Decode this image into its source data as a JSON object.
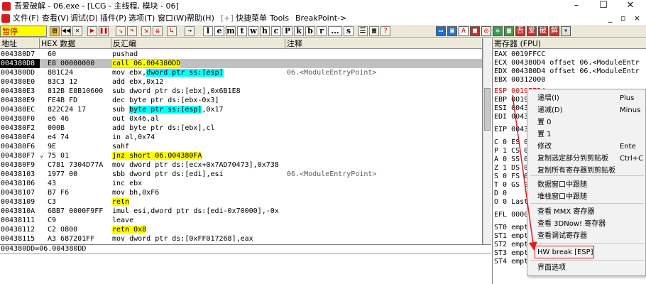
{
  "titlebar": {
    "title": "吾爱破解 - 06.exe - [LCG - 主线程, 模块 - 06]",
    "min": "–",
    "max": "☐",
    "close": "✕"
  },
  "menubar": {
    "items": [
      "文件(F)",
      "查看(V)",
      "调试(D)",
      "插件(P)",
      "选项(T)",
      "窗口(W)",
      "帮助(H)",
      "[+]",
      "快捷菜单",
      "Tools",
      "BreakPoint->"
    ],
    "mdi": "_ ▫ ×"
  },
  "toolbar": {
    "status": "暂停",
    "letters": [
      "l",
      "e",
      "m",
      "t",
      "w",
      "h",
      "c",
      "P",
      "k",
      "b",
      "r",
      "...",
      "s"
    ]
  },
  "cpu": {
    "headers": {
      "address": "地址",
      "hex": "HEX 数据",
      "disasm": "反汇编",
      "comment": "注释"
    },
    "rows": [
      {
        "addr": "004380D7",
        "mark": "",
        "hex": "60",
        "dis": "pushad",
        "cmt": ""
      },
      {
        "addr": "004380D8",
        "mark": "",
        "hex": "E8 00000000",
        "dis": "call 06.004380DD",
        "cmt": ""
      },
      {
        "addr": "004380DD",
        "mark": "",
        "hex": "8B1C24",
        "dis": "mov ebx,dword ptr ss:[esp]",
        "cmt": "06.<ModuleEntryPoint>"
      },
      {
        "addr": "004380E0",
        "mark": "",
        "hex": "83C3 12",
        "dis": "add ebx,0x12",
        "cmt": ""
      },
      {
        "addr": "004380E3",
        "mark": "",
        "hex": "812B E8B10600",
        "dis": "sub dword ptr ds:[ebx],0x6B1E8",
        "cmt": ""
      },
      {
        "addr": "004380E9",
        "mark": "",
        "hex": "FE4B FD",
        "dis": "dec byte ptr ds:[ebx-0x3]",
        "cmt": ""
      },
      {
        "addr": "004380EC",
        "mark": "",
        "hex": "822C24 17",
        "dis": "sub byte ptr ss:[esp],0x17",
        "cmt": ""
      },
      {
        "addr": "004380F0",
        "mark": "",
        "hex": "e6 46",
        "dis": "out 0x46,al",
        "cmt": ""
      },
      {
        "addr": "004380F2",
        "mark": "",
        "hex": "000B",
        "dis": "add byte ptr ds:[ebx],cl",
        "cmt": ""
      },
      {
        "addr": "004380F4",
        "mark": "",
        "hex": "e4 74",
        "dis": "in al,0x74",
        "cmt": ""
      },
      {
        "addr": "004380F6",
        "mark": "",
        "hex": "9E",
        "dis": "sahf",
        "cmt": ""
      },
      {
        "addr": "004380F7",
        "mark": "⌄",
        "hex": "75 01",
        "dis": "jnz short 06.004380FA",
        "cmt": ""
      },
      {
        "addr": "004380F9",
        "mark": "",
        "hex": "C781 7304D77A",
        "dis": "mov dword ptr ds:[ecx+0x7AD70473],0x738",
        "cmt": ""
      },
      {
        "addr": "00438103",
        "mark": "",
        "hex": "1977 00",
        "dis": "sbb dword ptr ds:[edi],esi",
        "cmt": "06.<ModuleEntryPoint>"
      },
      {
        "addr": "00438106",
        "mark": "",
        "hex": "43",
        "dis": "inc ebx",
        "cmt": ""
      },
      {
        "addr": "00438107",
        "mark": "",
        "hex": "B7 F6",
        "dis": "mov bh,0xF6",
        "cmt": ""
      },
      {
        "addr": "00438109",
        "mark": "",
        "hex": "C3",
        "dis": "retn",
        "cmt": ""
      },
      {
        "addr": "0043810A",
        "mark": "",
        "hex": "6BB7 0000F9FF",
        "dis": "imul esi,dword ptr ds:[edi-0x70000],-0x",
        "cmt": ""
      },
      {
        "addr": "00438111",
        "mark": "",
        "hex": "C9",
        "dis": "leave",
        "cmt": ""
      },
      {
        "addr": "00438112",
        "mark": "",
        "hex": "C2 0800",
        "dis": "retn 0x8",
        "cmt": ""
      },
      {
        "addr": "00438115",
        "mark": "",
        "hex": "A3 687201FF",
        "dis": "mov dword ptr ds:[0xFF017268],eax",
        "cmt": ""
      }
    ]
  },
  "info_line": "004380DD=06.004380DD",
  "registers": {
    "header": "寄存器 (FPU)",
    "lines": [
      {
        "text": "EAX 0019FFCC",
        "red": false
      },
      {
        "text": "ECX 004380D4 offset 06.<ModuleEntr",
        "red": false
      },
      {
        "text": "EDX 004380D4 offset 06.<ModuleEntr",
        "red": false
      },
      {
        "text": "EBX 00312000",
        "red": false
      },
      {
        "text": "ESP 0019FF54",
        "red": true
      },
      {
        "text": "EBP 0019FF80",
        "red": false
      },
      {
        "text": "ESI 004380D4",
        "red": false
      },
      {
        "text": "EDI 004380D4",
        "red": false
      },
      {
        "text": "EIP 004380D8",
        "red": false
      },
      {
        "text": "C 0  ES 002B",
        "red": false
      },
      {
        "text": "P 1  CS 0023",
        "red": false
      },
      {
        "text": "A 0  SS 002B",
        "red": false
      },
      {
        "text": "Z 1  DS 002B",
        "red": false
      },
      {
        "text": "S 0  FS 0053",
        "red": false
      },
      {
        "text": "T 0  GS 002B",
        "red": false
      },
      {
        "text": "D 0",
        "red": false
      },
      {
        "text": "O 0  LastErr",
        "red": false
      },
      {
        "text": "EFL 00000246",
        "red": false
      },
      {
        "text": "ST0 empty 0.0",
        "red": false
      },
      {
        "text": "ST1 empty 0.0",
        "red": false
      },
      {
        "text": "ST2 empty 0.0",
        "red": false
      },
      {
        "text": "ST3 empty 0.0",
        "red": false
      },
      {
        "text": "ST4 empty 0.0",
        "red": false
      }
    ]
  },
  "context_menu": {
    "items": [
      {
        "label": "递增(I)",
        "shortcut": "Plus"
      },
      {
        "label": "递减(D)",
        "shortcut": "Minus"
      },
      {
        "label": "置 0",
        "shortcut": ""
      },
      {
        "label": "置 1",
        "shortcut": ""
      },
      {
        "label": "修改",
        "shortcut": "Ente"
      },
      {
        "label": "复制选定部分到剪贴板",
        "shortcut": "Ctrl+C"
      },
      {
        "label": "复制所有寄存器到剪贴板",
        "shortcut": ""
      },
      {
        "label": "数据窗口中跟随",
        "shortcut": ""
      },
      {
        "label": "堆栈窗口中跟随",
        "shortcut": ""
      },
      {
        "label": "查看 MMX 寄存器",
        "shortcut": ""
      },
      {
        "label": "查看 3DNow! 寄存器",
        "shortcut": ""
      },
      {
        "label": "查看调试寄存器",
        "shortcut": ""
      },
      {
        "label": "HW break [ESP]",
        "shortcut": ""
      },
      {
        "label": "界面选项",
        "shortcut": ""
      }
    ]
  },
  "colors": {
    "selection": "#c0c0c0",
    "highlight_cyan": "#00ffff",
    "highlight_yellow": "#ffff00",
    "annotation_red": "#e02020"
  }
}
